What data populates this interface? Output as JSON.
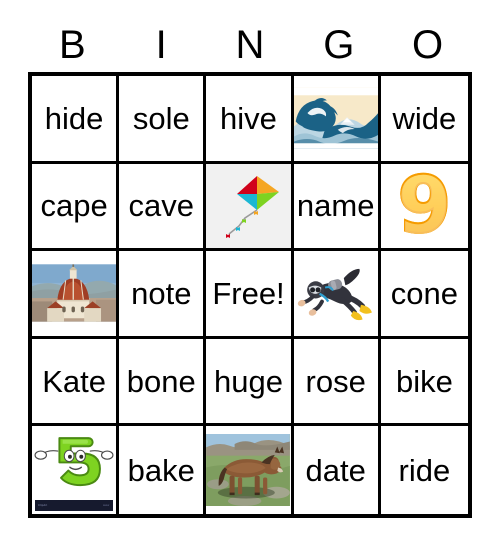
{
  "card": {
    "title": "BINGO card",
    "header_letters": [
      "B",
      "I",
      "N",
      "G",
      "O"
    ],
    "free_space_label": "Free!",
    "columns": 5,
    "rows": 5,
    "colors": {
      "border": "#000000",
      "cell_background": "#ffffff",
      "text": "#000000",
      "kite_cell_background": "#f1f1f1",
      "nine_fill": "#ffb400",
      "nine_outline": "#f59b00",
      "five_fill": "#7ed321"
    },
    "cells": [
      [
        {
          "type": "text",
          "value": "hide"
        },
        {
          "type": "text",
          "value": "sole"
        },
        {
          "type": "text",
          "value": "hive"
        },
        {
          "type": "image",
          "value": "great-wave-image",
          "alt": "Great Wave off Kanagawa"
        },
        {
          "type": "text",
          "value": "wide"
        }
      ],
      [
        {
          "type": "text",
          "value": "cape"
        },
        {
          "type": "text",
          "value": "cave"
        },
        {
          "type": "image",
          "value": "kite-image",
          "alt": "kite"
        },
        {
          "type": "text",
          "value": "name"
        },
        {
          "type": "image",
          "value": "number-nine-image",
          "alt": "number 9",
          "label": "9"
        }
      ],
      [
        {
          "type": "image",
          "value": "cathedral-dome-image",
          "alt": "Florence Duomo cathedral dome"
        },
        {
          "type": "text",
          "value": "note"
        },
        {
          "type": "text",
          "value": "Free!"
        },
        {
          "type": "image",
          "value": "scuba-diver-image",
          "alt": "scuba diver"
        },
        {
          "type": "text",
          "value": "cone"
        }
      ],
      [
        {
          "type": "text",
          "value": "Kate"
        },
        {
          "type": "text",
          "value": "bone"
        },
        {
          "type": "text",
          "value": "huge"
        },
        {
          "type": "text",
          "value": "rose"
        },
        {
          "type": "text",
          "value": "bike"
        }
      ],
      [
        {
          "type": "image",
          "value": "number-five-cartoon-image",
          "alt": "cartoon number 5",
          "label": "5"
        },
        {
          "type": "text",
          "value": "bake"
        },
        {
          "type": "image",
          "value": "horse-image",
          "alt": "brown horse in field"
        },
        {
          "type": "text",
          "value": "date"
        },
        {
          "type": "text",
          "value": "ride"
        }
      ]
    ]
  }
}
